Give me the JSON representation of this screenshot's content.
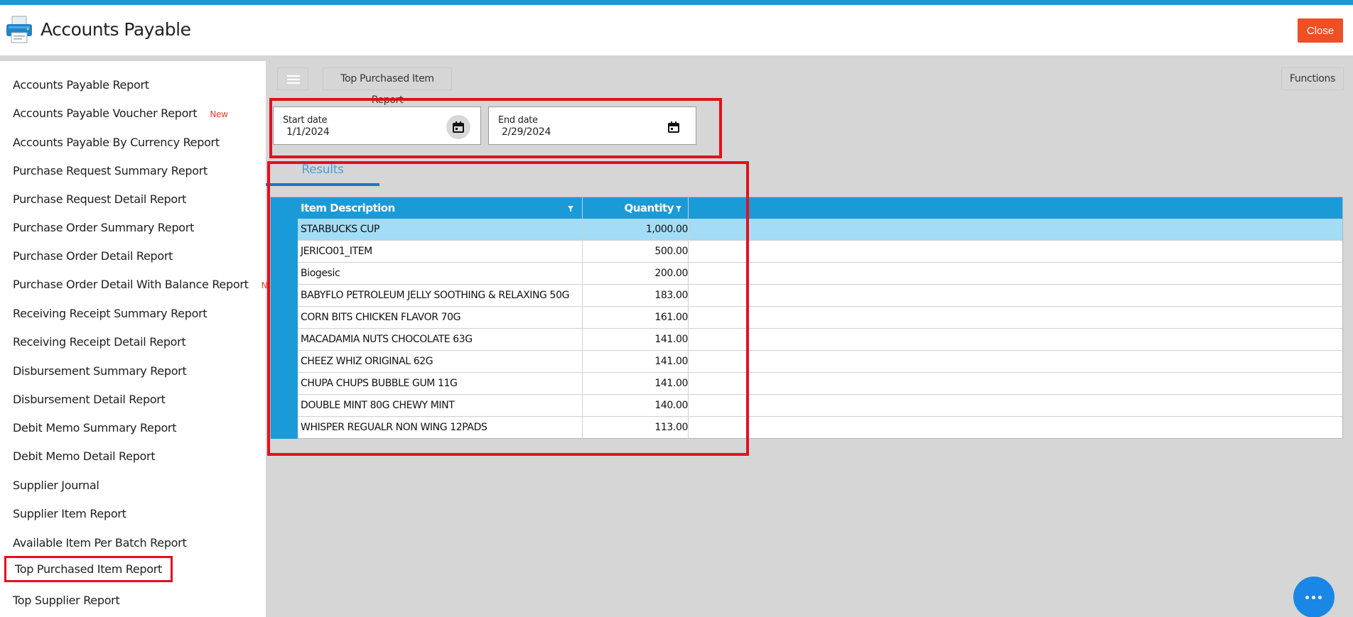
{
  "app": {
    "title": "Accounts Payable",
    "close_label": "Close",
    "accent_color": "#1a9ad6",
    "close_color": "#f04e23"
  },
  "sidebar": {
    "items": [
      {
        "label": "Accounts Payable Report",
        "badge": ""
      },
      {
        "label": "Accounts Payable Voucher Report",
        "badge": "New"
      },
      {
        "label": "Accounts Payable By Currency Report",
        "badge": ""
      },
      {
        "label": "Purchase Request Summary Report",
        "badge": ""
      },
      {
        "label": "Purchase Request Detail Report",
        "badge": ""
      },
      {
        "label": "Purchase Order Summary Report",
        "badge": ""
      },
      {
        "label": "Purchase Order Detail Report",
        "badge": ""
      },
      {
        "label": "Purchase Order Detail With Balance Report",
        "badge": "New"
      },
      {
        "label": "Receiving Receipt Summary Report",
        "badge": ""
      },
      {
        "label": "Receiving Receipt Detail Report",
        "badge": ""
      },
      {
        "label": "Disbursement Summary Report",
        "badge": ""
      },
      {
        "label": "Disbursement Detail Report",
        "badge": ""
      },
      {
        "label": "Debit Memo Summary Report",
        "badge": ""
      },
      {
        "label": "Debit Memo Detail Report",
        "badge": ""
      },
      {
        "label": "Supplier Journal",
        "badge": ""
      },
      {
        "label": "Supplier Item Report",
        "badge": ""
      },
      {
        "label": "Available Item Per Batch Report",
        "badge": ""
      },
      {
        "label": "Top Purchased Item Report",
        "badge": "",
        "active": true
      },
      {
        "label": "Top Supplier Report",
        "badge": ""
      }
    ]
  },
  "toolbar": {
    "menu_icon": "hamburger-icon",
    "report_tab": "Top Purchased Item Report",
    "functions_label": "Functions"
  },
  "filters": {
    "start_date": {
      "label": "Start date",
      "value": "1/1/2024",
      "icon": "calendar-icon"
    },
    "end_date": {
      "label": "End date",
      "value": "2/29/2024",
      "icon": "calendar-icon"
    }
  },
  "results": {
    "tab_label": "Results",
    "columns": [
      "Item Description",
      "Quantity"
    ],
    "rows": [
      {
        "desc": "STARBUCKS CUP",
        "qty": "1,000.00"
      },
      {
        "desc": "JERICO01_ITEM",
        "qty": "500.00"
      },
      {
        "desc": "Biogesic",
        "qty": "200.00"
      },
      {
        "desc": "BABYFLO PETROLEUM JELLY SOOTHING & RELAXING 50G",
        "qty": "183.00"
      },
      {
        "desc": "CORN BITS CHICKEN FLAVOR 70G",
        "qty": "161.00"
      },
      {
        "desc": "MACADAMIA NUTS CHOCOLATE 63G",
        "qty": "141.00"
      },
      {
        "desc": "CHEEZ WHIZ ORIGINAL 62G",
        "qty": "141.00"
      },
      {
        "desc": "CHUPA CHUPS BUBBLE GUM 11G",
        "qty": "141.00"
      },
      {
        "desc": "DOUBLE MINT 80G CHEWY MINT",
        "qty": "140.00"
      },
      {
        "desc": "WHISPER REGUALR NON WING 12PADS",
        "qty": "113.00"
      }
    ]
  },
  "fab": {
    "icon": "more-dots-icon"
  }
}
